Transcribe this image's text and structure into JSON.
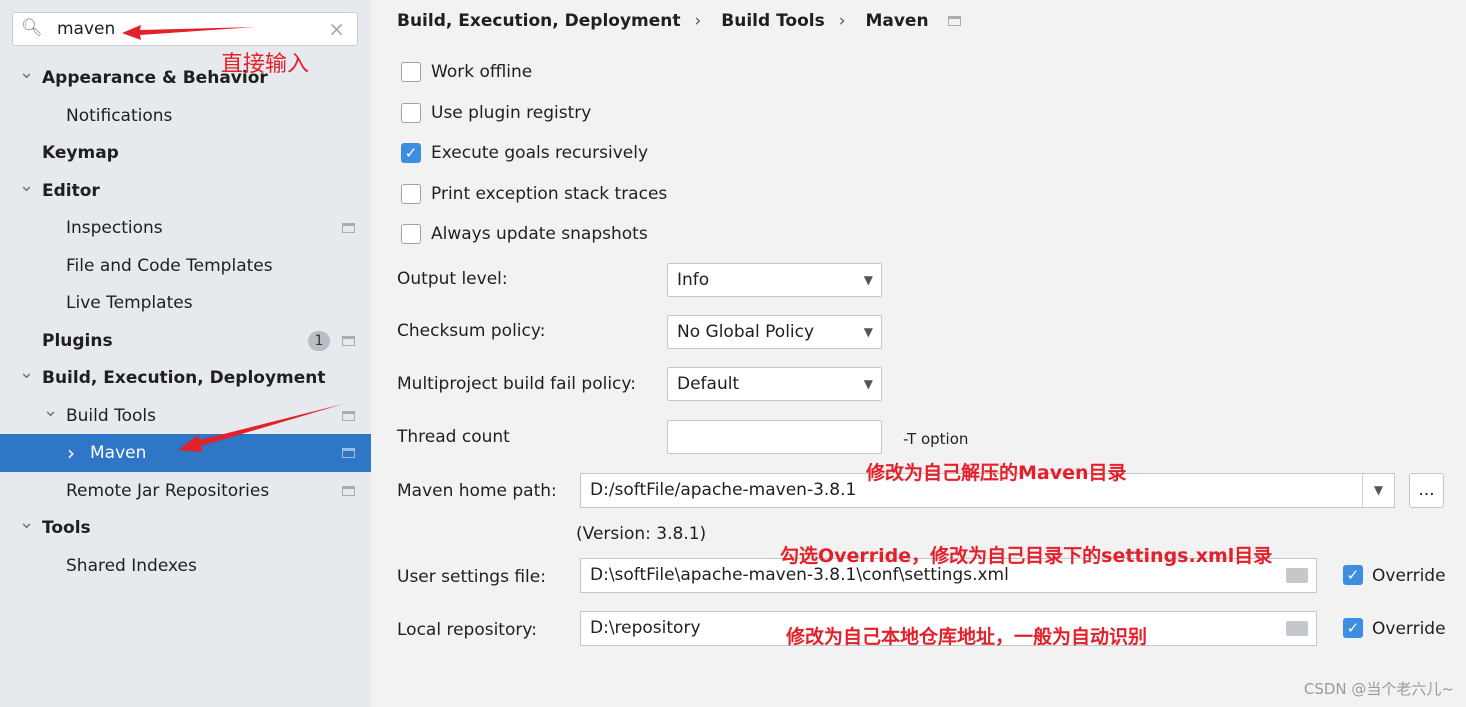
{
  "search": {
    "value": "maven",
    "icon": "search-icon",
    "clear_icon": "close-icon"
  },
  "sidebar": {
    "items": [
      {
        "label": "Appearance & Behavior",
        "bold": true,
        "chev": "down"
      },
      {
        "label": "Notifications"
      },
      {
        "label": "Keymap",
        "bold": true
      },
      {
        "label": "Editor",
        "bold": true,
        "chev": "down"
      },
      {
        "label": "Inspections",
        "pin": true
      },
      {
        "label": "File and Code Templates"
      },
      {
        "label": "Live Templates"
      },
      {
        "label": "Plugins",
        "bold": true,
        "badge": "1",
        "pin": true
      },
      {
        "label": "Build, Execution, Deployment",
        "bold": true,
        "chev": "down"
      },
      {
        "label": "Build Tools",
        "chev": "down",
        "pin": true
      },
      {
        "label": "Maven",
        "chev": "right",
        "pin": true,
        "selected": true
      },
      {
        "label": "Remote Jar Repositories",
        "pin": true
      },
      {
        "label": "Tools",
        "bold": true,
        "chev": "down"
      },
      {
        "label": "Shared Indexes"
      }
    ]
  },
  "breadcrumb": [
    "Build, Execution, Deployment",
    "Build Tools",
    "Maven"
  ],
  "checkboxes": [
    {
      "label": "Work offline",
      "checked": false
    },
    {
      "label": "Use plugin registry",
      "checked": false
    },
    {
      "label": "Execute goals recursively",
      "checked": true
    },
    {
      "label": "Print exception stack traces",
      "checked": false
    },
    {
      "label": "Always update snapshots",
      "checked": false
    }
  ],
  "fields": {
    "output_level": {
      "label": "Output level:",
      "value": "Info"
    },
    "checksum": {
      "label": "Checksum policy:",
      "value": "No Global Policy"
    },
    "fail_policy": {
      "label": "Multiproject build fail policy:",
      "value": "Default"
    },
    "thread_count": {
      "label": "Thread count",
      "value": "",
      "hint": "-T option"
    },
    "maven_home": {
      "label": "Maven home path:",
      "value": "D:/softFile/apache-maven-3.8.1",
      "browse": "...",
      "version": "(Version: 3.8.1)"
    },
    "user_settings": {
      "label": "User settings file:",
      "value": "D:\\softFile\\apache-maven-3.8.1\\conf\\settings.xml",
      "override": "Override",
      "override_checked": true
    },
    "local_repo": {
      "label": "Local repository:",
      "value": "D:\\repository",
      "override": "Override",
      "override_checked": true
    }
  },
  "annotations": {
    "search": "直接输入",
    "maven_home": "修改为自己解压的Maven目录",
    "user_settings": "勾选Override，修改为自己目录下的settings.xml目录",
    "local_repo": "修改为自己本地仓库地址，一般为自动识别",
    "color": "#e4202a"
  },
  "watermark": "CSDN @当个老六儿~",
  "colors": {
    "selection": "#2f76c6",
    "checkbox": "#3d8de0"
  }
}
